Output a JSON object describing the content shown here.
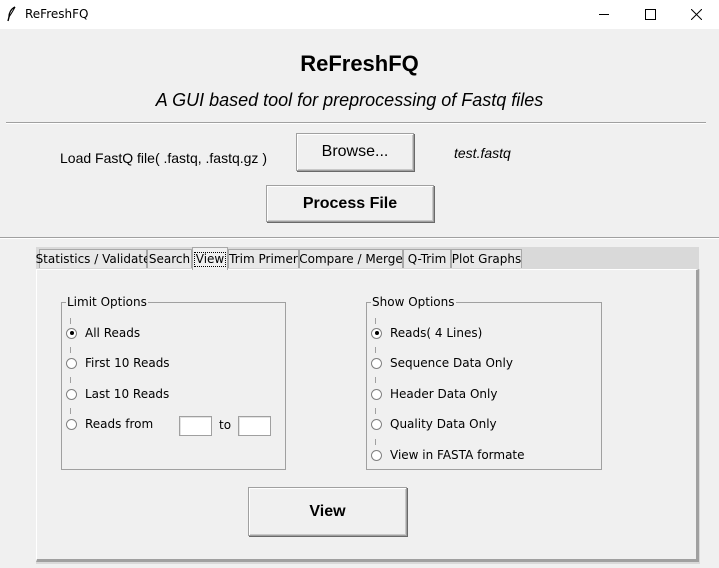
{
  "window": {
    "title": "ReFreshFQ",
    "icons": {
      "app": "feather-icon",
      "minimize": "minimize-icon",
      "maximize": "maximize-icon",
      "close": "close-icon"
    }
  },
  "header": {
    "title": "ReFreshFQ",
    "subtitle": "A GUI based tool for preprocessing of Fastq files"
  },
  "load": {
    "label": "Load FastQ file( .fastq, .fastq.gz )",
    "browse_label": "Browse...",
    "file_name": "test.fastq",
    "process_label": "Process File"
  },
  "tabs": [
    {
      "label": "Statistics / Validate",
      "active": false
    },
    {
      "label": "Search",
      "active": false
    },
    {
      "label": "View",
      "active": true
    },
    {
      "label": "Trim Primer",
      "active": false
    },
    {
      "label": "Compare / Merge",
      "active": false
    },
    {
      "label": "Q-Trim",
      "active": false
    },
    {
      "label": "Plot Graphs",
      "active": false
    }
  ],
  "view_tab": {
    "limit_options": {
      "title": "Limit Options",
      "options": [
        {
          "label": "All Reads",
          "checked": true
        },
        {
          "label": "First 10 Reads",
          "checked": false
        },
        {
          "label": "Last 10 Reads",
          "checked": false
        },
        {
          "label": "Reads from",
          "checked": false
        }
      ],
      "range_from": "",
      "range_to_label": "to",
      "range_to": ""
    },
    "show_options": {
      "title": "Show Options",
      "options": [
        {
          "label": "Reads( 4 Lines)",
          "checked": true
        },
        {
          "label": "Sequence Data Only",
          "checked": false
        },
        {
          "label": "Header Data Only",
          "checked": false
        },
        {
          "label": "Quality Data Only",
          "checked": false
        },
        {
          "label": "View in FASTA formate",
          "checked": false
        }
      ]
    },
    "view_button_label": "View"
  }
}
